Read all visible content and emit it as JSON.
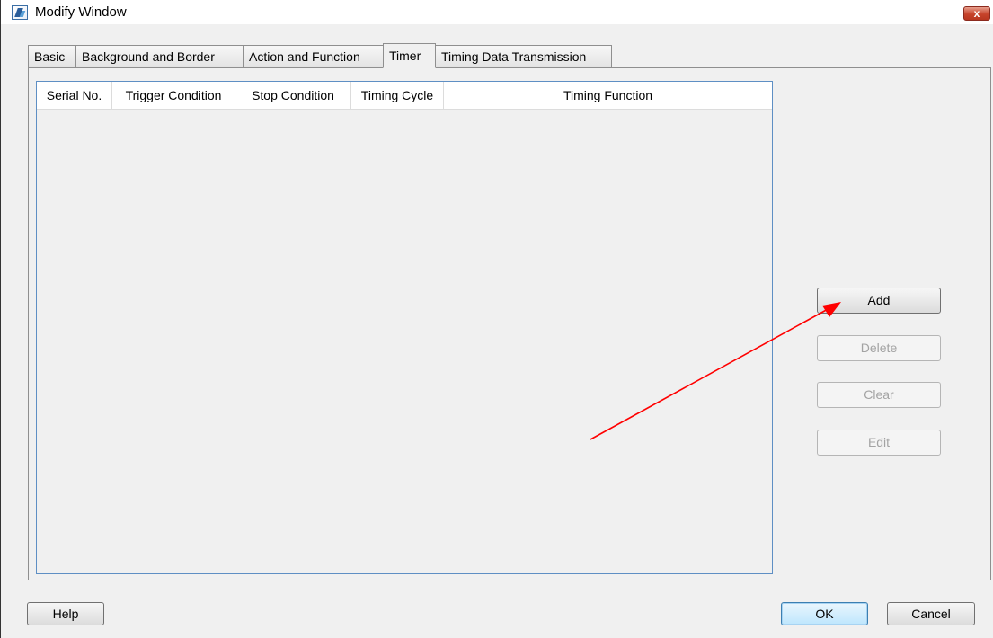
{
  "window": {
    "title": "Modify Window",
    "close_label": "x"
  },
  "tabs": [
    {
      "label": "Basic",
      "active": false
    },
    {
      "label": "Background and Border",
      "active": false
    },
    {
      "label": "Action and Function",
      "active": false
    },
    {
      "label": "Timer",
      "active": true
    },
    {
      "label": "Timing Data Transmission",
      "active": false
    }
  ],
  "timer_list": {
    "columns": [
      "Serial No.",
      "Trigger Condition",
      "Stop Condition",
      "Timing Cycle",
      "Timing Function"
    ],
    "rows": []
  },
  "side_buttons": {
    "add": "Add",
    "delete": "Delete",
    "clear": "Clear",
    "edit": "Edit"
  },
  "footer": {
    "help": "Help",
    "ok": "OK",
    "cancel": "Cancel"
  },
  "colors": {
    "annotation_arrow": "#ff0000",
    "list_border": "#5e8fc4"
  },
  "icons": {
    "app": "app-icon",
    "close": "close-icon"
  }
}
